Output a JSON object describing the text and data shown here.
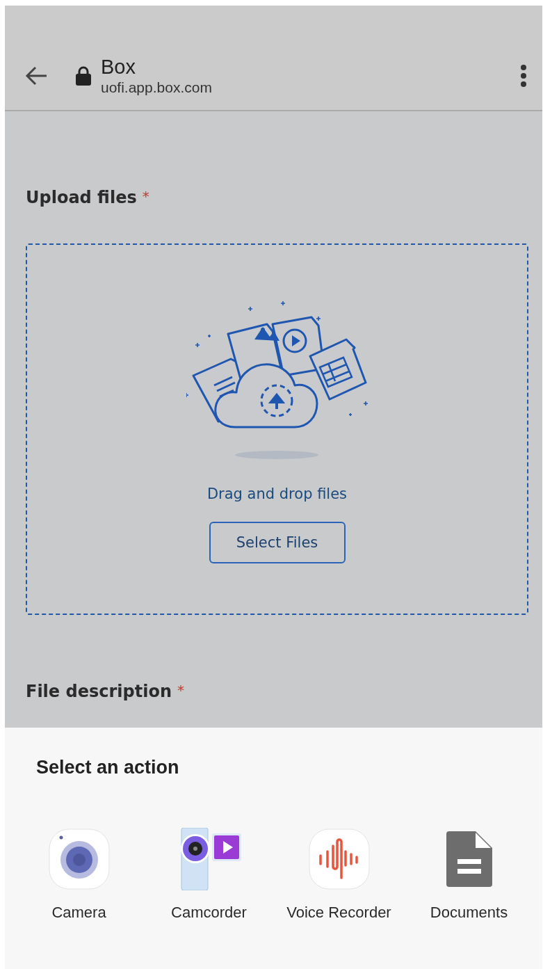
{
  "header": {
    "title": "Box",
    "url": "uofi.app.box.com"
  },
  "upload": {
    "label": "Upload files",
    "required_mark": "*",
    "drop_text": "Drag and drop files",
    "button": "Select Files"
  },
  "description": {
    "label": "File description",
    "required_mark": "*"
  },
  "sheet": {
    "title": "Select an action",
    "actions": [
      {
        "kind": "camera",
        "label": "Camera"
      },
      {
        "kind": "camcorder",
        "label": "Camcorder"
      },
      {
        "kind": "recorder",
        "label": "Voice Recorder"
      },
      {
        "kind": "documents",
        "label": "Documents"
      }
    ]
  }
}
